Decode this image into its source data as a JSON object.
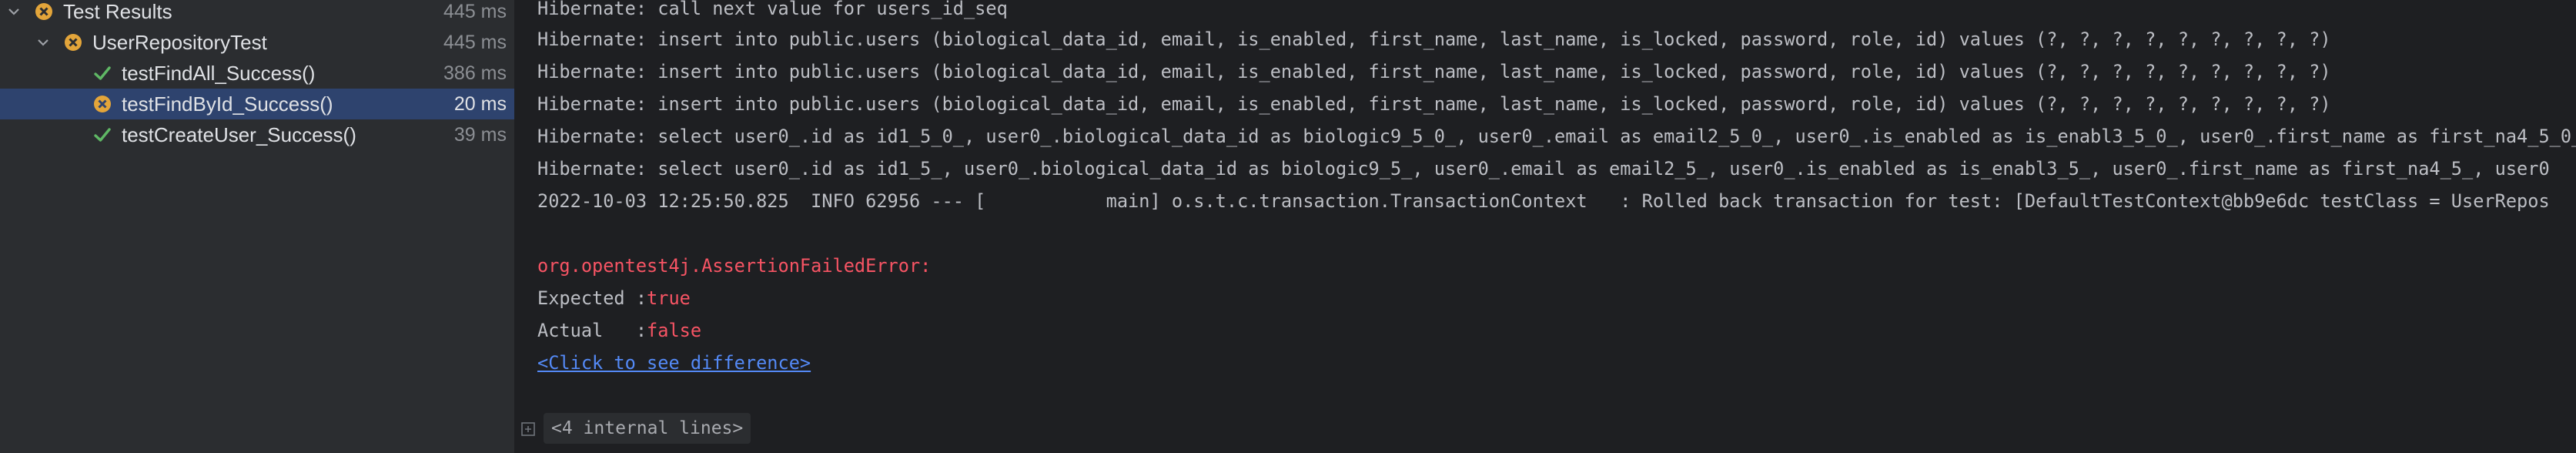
{
  "tree": {
    "items": [
      {
        "label": "Test Results",
        "time": "445 ms",
        "status": "fail",
        "expanded": true
      },
      {
        "label": "UserRepositoryTest",
        "time": "445 ms",
        "status": "fail",
        "expanded": true
      },
      {
        "label": "testFindAll_Success()",
        "time": "386 ms",
        "status": "pass"
      },
      {
        "label": "testFindById_Success()",
        "time": "20 ms",
        "status": "fail",
        "selected": true
      },
      {
        "label": "testCreateUser_Success()",
        "time": "39 ms",
        "status": "pass"
      }
    ]
  },
  "console": {
    "lines": [
      "Hibernate: call next value for users_id_seq",
      "Hibernate: insert into public.users (biological_data_id, email, is_enabled, first_name, last_name, is_locked, password, role, id) values (?, ?, ?, ?, ?, ?, ?, ?, ?)",
      "Hibernate: insert into public.users (biological_data_id, email, is_enabled, first_name, last_name, is_locked, password, role, id) values (?, ?, ?, ?, ?, ?, ?, ?, ?)",
      "Hibernate: insert into public.users (biological_data_id, email, is_enabled, first_name, last_name, is_locked, password, role, id) values (?, ?, ?, ?, ?, ?, ?, ?, ?)",
      "Hibernate: select user0_.id as id1_5_0_, user0_.biological_data_id as biologic9_5_0_, user0_.email as email2_5_0_, user0_.is_enabled as is_enabl3_5_0_, user0_.first_name as first_na4_5_0_",
      "Hibernate: select user0_.id as id1_5_, user0_.biological_data_id as biologic9_5_, user0_.email as email2_5_, user0_.is_enabled as is_enabl3_5_, user0_.first_name as first_na4_5_, user0",
      "2022-10-03 12:25:50.825  INFO 62956 --- [           main] o.s.t.c.transaction.TransactionContext   : Rolled back transaction for test: [DefaultTestContext@bb9e6dc testClass = UserRepos"
    ],
    "error_class": "org.opentest4j.AssertionFailedError:",
    "expected_label": "Expected :",
    "expected_value": "true",
    "actual_label": "Actual   :",
    "actual_value": "false",
    "diff_link": "<Click to see difference>",
    "folded_label": "<4 internal lines>"
  },
  "colors": {
    "pass": "#5fb865",
    "fail": "#e3a53a",
    "error_text": "#f75464",
    "link": "#548af7"
  },
  "icons": [
    "chevron-down-icon",
    "fail-status-icon",
    "pass-check-icon",
    "fold-expand-icon"
  ]
}
